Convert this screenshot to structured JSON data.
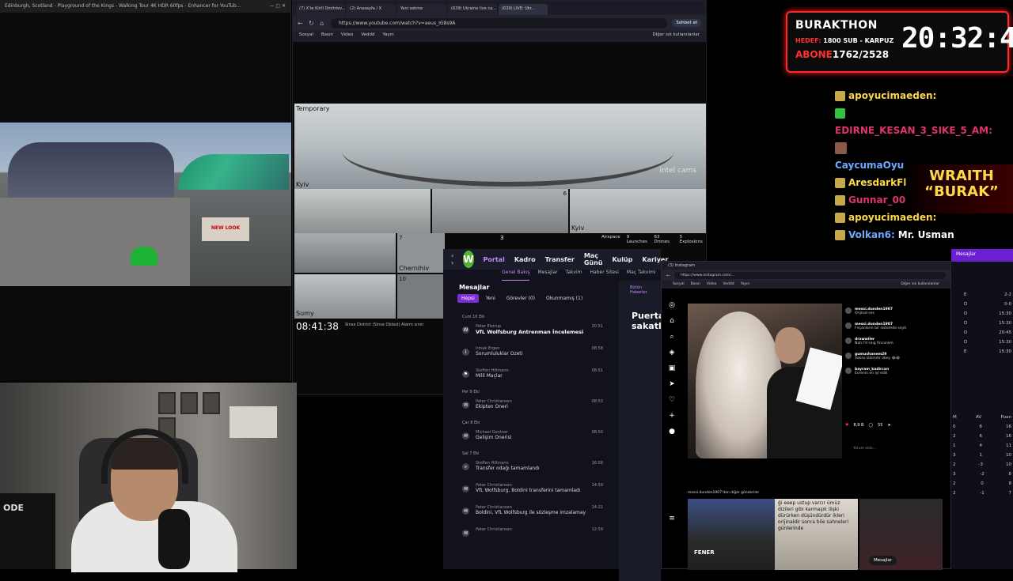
{
  "left_window": {
    "title": "Edinburgh, Scotland - Playground of the Kings - Walking Tour 4K HDR 60fps - Enhancer for YouTub...",
    "shop_sign": "NEW LOOK"
  },
  "mid_window": {
    "tabs": [
      "(7) X'te Kirill Dmitriev...",
      "(2) Anasayfa / X",
      "Yeni sekme",
      "(639) Ukraine live ca...",
      "(639) LIVE: Ukr..."
    ],
    "url": "https://www.youtube.com/watch?v=aeus_IG8s9A",
    "sohbet": "Sohbet et",
    "bookmarks": [
      "Sosyal",
      "Basın",
      "Video",
      "Veddd",
      "Yayın"
    ],
    "bookmarks_right": "Diğer sık kullanılanlar",
    "cam_labels": {
      "temporary": "Temporary",
      "kyiv1": "Kyiv",
      "kyiv2": "Kyiv",
      "chernihiv": "Chernihiv",
      "sumy": "Sumy"
    },
    "cam_numbers": {
      "n6": "6",
      "n7": "7",
      "n3": "3",
      "n10": "10"
    },
    "watermark": "intel cams",
    "clock": "08:41:38",
    "status_text": "Sinse District (Sinse Oblast) Alarm sınırı",
    "airspace": [
      "Airspace",
      "9 Launches",
      "63 Drones",
      "5 Explosions"
    ]
  },
  "fm_window": {
    "nav": [
      "Portal",
      "Kadro",
      "Transfer",
      "Maç Günü",
      "Kulüp",
      "Kariyer"
    ],
    "subnav": [
      "Genel Bakış",
      "Mesajlar",
      "Takvim",
      "Haber Sitesi",
      "Maç Takvimi"
    ],
    "messages_title": "Mesajlar",
    "filters": [
      "Hepsi",
      "Yeni",
      "Görevler (0)",
      "Okunmamış (1)"
    ],
    "list": [
      {
        "day": "Cum 10 Eki",
        "sender": "Peter Elstrup",
        "subject": "VfL Wolfsburg Antrenman İncelemesi",
        "time": "20:51",
        "bold": true,
        "icon": "W"
      },
      {
        "day": "",
        "sender": "Irmak Ergen",
        "subject": "Sorumluluklar Özeti",
        "time": "08:58",
        "bold": false,
        "icon": "i"
      },
      {
        "day": "",
        "sender": "Steffen Hillmann",
        "subject": "Milli Maçlar",
        "time": "08:51",
        "bold": false,
        "icon": "⚑"
      },
      {
        "day": "Per 9 Eki",
        "sender": "Peter Christiansen",
        "subject": "Ekipten Öneri",
        "time": "08:53",
        "bold": false,
        "icon": "✉"
      },
      {
        "day": "Çar 8 Eki",
        "sender": "Michael Gentner",
        "subject": "Gelişim Önerisi",
        "time": "08:50",
        "bold": false,
        "icon": "✉"
      },
      {
        "day": "Sal 7 Eki",
        "sender": "Steffen Hillmann",
        "subject": "Transfer odağı tamamlandı",
        "time": "16:58",
        "bold": false,
        "icon": "⌕"
      },
      {
        "day": "",
        "sender": "Peter Christiansen",
        "subject": "VfL Wolfsburg, Boldini transferini tamamladı",
        "time": "14:59",
        "bold": false,
        "icon": "✉"
      },
      {
        "day": "",
        "sender": "Peter Christiansen",
        "subject": "Boldini, VfL Wolfsburg ile sözleşme imzalamaya...",
        "time": "14:21",
        "bold": false,
        "icon": "✉"
      },
      {
        "day": "",
        "sender": "Peter Christiansen",
        "subject": "",
        "time": "12:59",
        "bold": false,
        "icon": "✉"
      }
    ],
    "right_headline": "Puerta sakatl",
    "right_label": "Bütün Haberler"
  },
  "ig_window": {
    "tab": "(3) Instagram",
    "url": "https://www.instagram.com/...",
    "bookmarks": [
      "Sosyal",
      "Basın",
      "Video",
      "Veddd",
      "Yayın"
    ],
    "bookmarks_right": "Diğer sık kullanılanlar",
    "comments": [
      {
        "user": "messi.dunden1907",
        "text": "Orijinal ses"
      },
      {
        "user": "messi.dunden1907",
        "text": "Fırçanların bir sistemde seyit"
      },
      {
        "user": "drawwiler",
        "text": "Nah I'd sing fincanlım"
      },
      {
        "user": "gumushanem29",
        "text": "Sakso lazımdır abey 😂😂"
      },
      {
        "user": "bayram_kadircan",
        "text": "Evrenin en iyi edili"
      }
    ],
    "likes": "8,9 B",
    "comment_count": "55",
    "comment_placeholder": "Yorum ekle...",
    "shared_from": "messi.dunden1907'dan diğer gönderiler",
    "reel_caption": "ği eeep ustup varcır ümüz dizileri gibi karmaşık ilişki dürürken düşündürdür ikleri orijinaldir sonra bile sahneleri günlerinde",
    "messages_label": "Mesajlar",
    "fener_label": "FENER"
  },
  "far_window": {
    "bar": "Mesajlar",
    "table1": [
      [
        "E",
        "2-2"
      ],
      [
        "D",
        "0-0"
      ],
      [
        "D",
        "15:30"
      ],
      [
        "D",
        "15:30"
      ],
      [
        "D",
        "20:45"
      ],
      [
        "D",
        "15:30"
      ],
      [
        "E",
        "15:30"
      ]
    ],
    "table2_header": [
      "M",
      "AV",
      "Puan"
    ],
    "table2": [
      [
        "0",
        "6",
        "16"
      ],
      [
        "2",
        "6",
        "16"
      ],
      [
        "1",
        "4",
        "11"
      ],
      [
        "3",
        "1",
        "10"
      ],
      [
        "2",
        "-3",
        "10"
      ],
      [
        "3",
        "-2",
        "8"
      ],
      [
        "2",
        "0",
        "8"
      ],
      [
        "2",
        "-1",
        "7"
      ]
    ]
  },
  "webcam": {
    "monitor_text": "ODE"
  },
  "overlay": {
    "title": "BURAKTHON",
    "hedef_label": "HEDEF:",
    "hedef_value": "1800 SUB - KARPUZ",
    "abone_label": "ABONE",
    "abone_value": "1762/2528",
    "clock": "20:32:47"
  },
  "chat": [
    {
      "user": "apoyucimaeden:",
      "msg": "",
      "color": "#ffd84a",
      "badge": "gold"
    },
    {
      "user": "",
      "msg": "",
      "color": "#ffd84a",
      "badge": "green"
    },
    {
      "user": "EDIRNE_KESAN_3_SIKE_5_AM:",
      "msg": "",
      "color": "#e0346f",
      "badge": ""
    },
    {
      "user": "",
      "msg": "",
      "color": "#ffd84a",
      "badge": "emote"
    },
    {
      "user": "CaycumaOyu",
      "msg": "",
      "color": "#6fa8ff",
      "badge": ""
    },
    {
      "user": "AresdarkFl",
      "msg": "",
      "color": "#ffd84a",
      "badge": "gold"
    },
    {
      "user": "Gunnar_00",
      "msg": "",
      "color": "#e0346f",
      "badge": "gold"
    },
    {
      "user": "apoyucimaeden:",
      "msg": "",
      "color": "#ffd84a",
      "badge": "gold"
    },
    {
      "user": "Volkan6:",
      "msg": "Mr. Usman",
      "color": "#6fa8ff",
      "badge": "gold"
    }
  ],
  "wraith": {
    "line1": "WRAITH",
    "line2": "“BURAK”"
  }
}
